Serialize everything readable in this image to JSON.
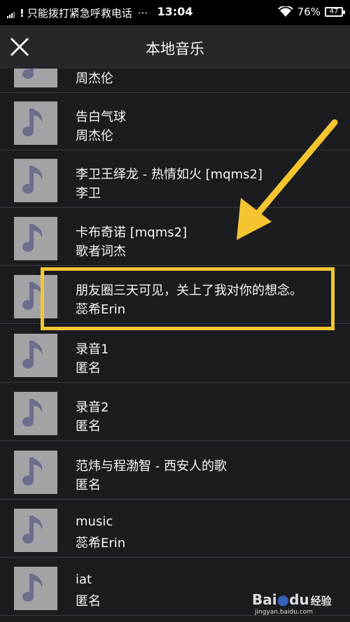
{
  "status_bar": {
    "carrier": "只能拨打紧急呼救电话",
    "more": "···",
    "time": "13:04",
    "battery_percent": "76%",
    "battery_label": "47"
  },
  "header": {
    "title": "本地音乐",
    "close_icon": "close-icon"
  },
  "songs": [
    {
      "title": "",
      "artist": "周杰伦"
    },
    {
      "title": "告白气球",
      "artist": "周杰伦"
    },
    {
      "title": "李卫王绎龙 - 热情如火 [mqms2]",
      "artist": "李卫"
    },
    {
      "title": "卡布奇诺 [mqms2]",
      "artist": "歌者词杰"
    },
    {
      "title": "朋友圈三天可见，关上了我对你的想念。",
      "artist": "蕊希Erin"
    },
    {
      "title": "录音1",
      "artist": "匿名"
    },
    {
      "title": "录音2",
      "artist": "匿名"
    },
    {
      "title": "范炜与程渤智 - 西安人的歌",
      "artist": "匿名"
    },
    {
      "title": "music",
      "artist": "蕊希Erin"
    },
    {
      "title": "iat",
      "artist": "匿名"
    }
  ],
  "thumbnail_icon": "music-note-icon",
  "colors": {
    "annotation": "#f4c531",
    "background": "#1b1c20",
    "header": "#26272b",
    "thumbnail": "#a3a3a6"
  },
  "watermark": {
    "brand": "Bai",
    "brand2": "du",
    "label": "经验",
    "url": "jingyan.baidu.com"
  }
}
